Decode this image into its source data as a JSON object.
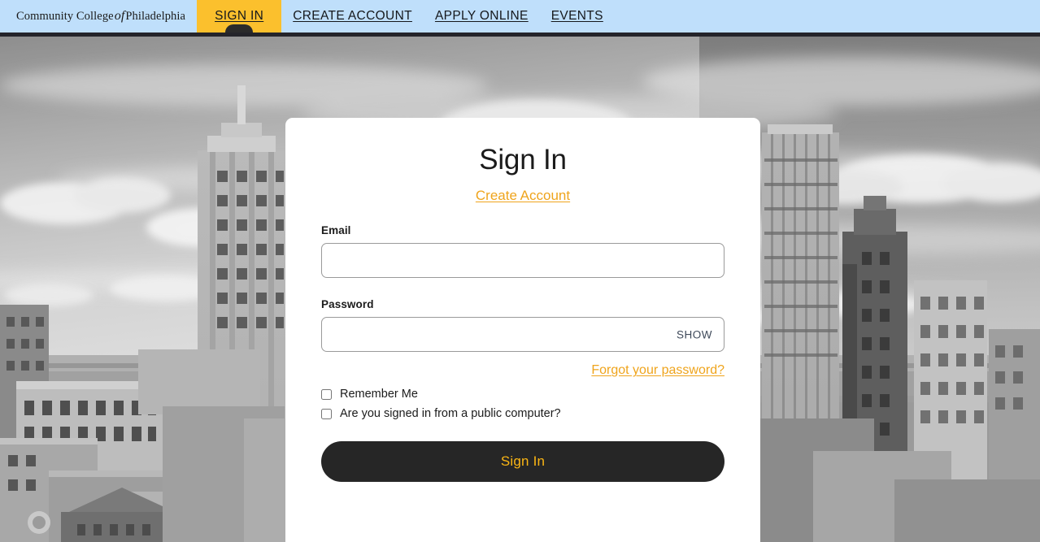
{
  "nav": {
    "brand": {
      "line_pre": "Community College",
      "line_of": "of",
      "line_post": "Philadelphia"
    },
    "items": [
      {
        "label": "SIGN IN",
        "active": true
      },
      {
        "label": "CREATE ACCOUNT",
        "active": false
      },
      {
        "label": "APPLY ONLINE",
        "active": false
      },
      {
        "label": "EVENTS",
        "active": false
      }
    ],
    "bar_color": "#bfdffb",
    "active_color": "#fbc02d",
    "underline_color": "#24242a"
  },
  "card": {
    "title": "Sign In",
    "create_account_link": "Create Account",
    "email": {
      "label": "Email",
      "value": "",
      "placeholder": ""
    },
    "password": {
      "label": "Password",
      "value": "",
      "placeholder": "",
      "show_label": "SHOW"
    },
    "forgot_link": "Forgot your password?",
    "checkboxes": [
      {
        "label": "Remember Me",
        "checked": false
      },
      {
        "label": "Are you signed in from a public computer?",
        "checked": false
      }
    ],
    "submit_label": "Sign In",
    "accent_color": "#efa41c",
    "submit_bg": "#262626",
    "submit_fg": "#fbb614"
  },
  "background": {
    "description": "Grayscale aerial photograph of the Philadelphia skyline with clouds"
  }
}
